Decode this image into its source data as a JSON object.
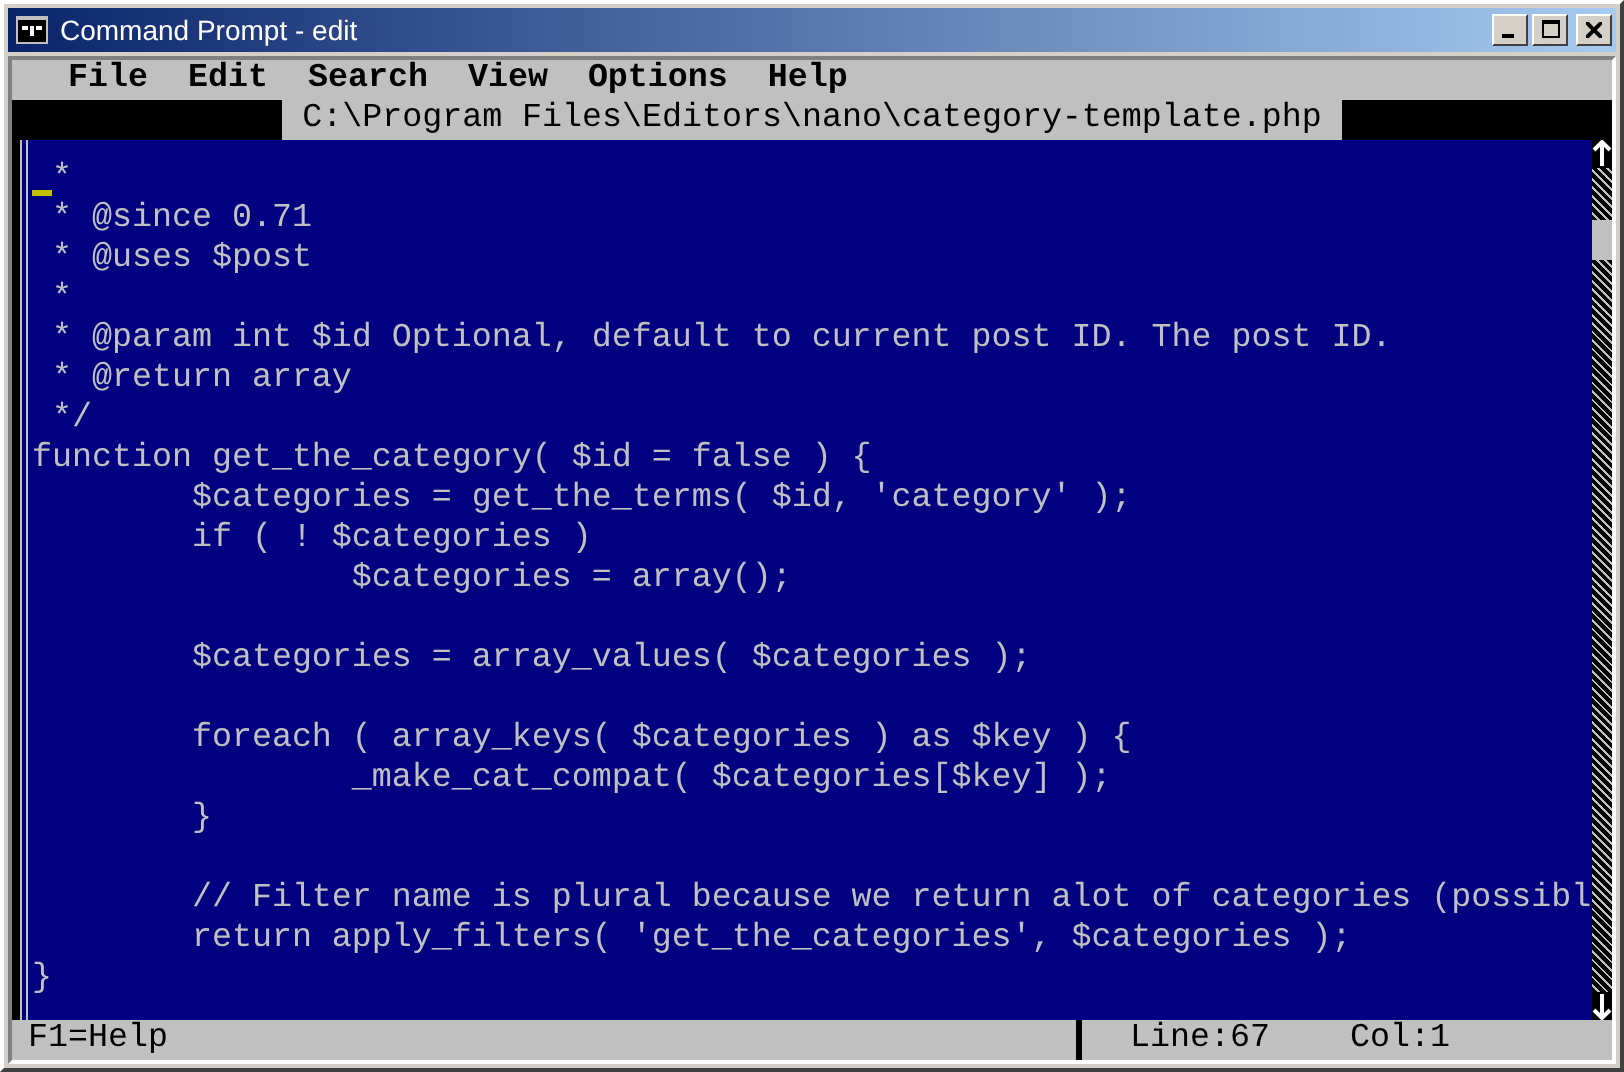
{
  "window": {
    "title": "Command Prompt - edit"
  },
  "menu": [
    "File",
    "Edit",
    "Search",
    "View",
    "Options",
    "Help"
  ],
  "file_path": "C:\\Program Files\\Editors\\nano\\category-template.php",
  "editor": {
    "lines": [
      {
        "text": " *",
        "cursor": true
      },
      {
        "text": " * @since 0.71",
        "cursor": false
      },
      {
        "text": " * @uses $post",
        "cursor": false
      },
      {
        "text": " *",
        "cursor": false
      },
      {
        "text": " * @param int $id Optional, default to current post ID. The post ID.",
        "cursor": false
      },
      {
        "text": " * @return array",
        "cursor": false
      },
      {
        "text": " */",
        "cursor": false
      },
      {
        "text": "function get_the_category( $id = false ) {",
        "cursor": false
      },
      {
        "text": "        $categories = get_the_terms( $id, 'category' );",
        "cursor": false
      },
      {
        "text": "        if ( ! $categories )",
        "cursor": false
      },
      {
        "text": "                $categories = array();",
        "cursor": false
      },
      {
        "cursor": false
      },
      {
        "text": "        $categories = array_values( $categories );",
        "cursor": false
      },
      {
        "cursor": false
      },
      {
        "text": "        foreach ( array_keys( $categories ) as $key ) {",
        "cursor": false
      },
      {
        "text": "                _make_cat_compat( $categories[$key] );",
        "cursor": false
      },
      {
        "text": "        }",
        "cursor": false
      },
      {
        "cursor": false
      },
      {
        "text": "        // Filter name is plural because we return alot of categories (possibl",
        "cursor": false
      },
      {
        "text": "        return apply_filters( 'get_the_categories', $categories );",
        "cursor": false
      },
      {
        "text": "}",
        "cursor": false
      }
    ]
  },
  "status_bar": {
    "help": "F1=Help",
    "line": "Line:67",
    "col": "Col:1"
  }
}
